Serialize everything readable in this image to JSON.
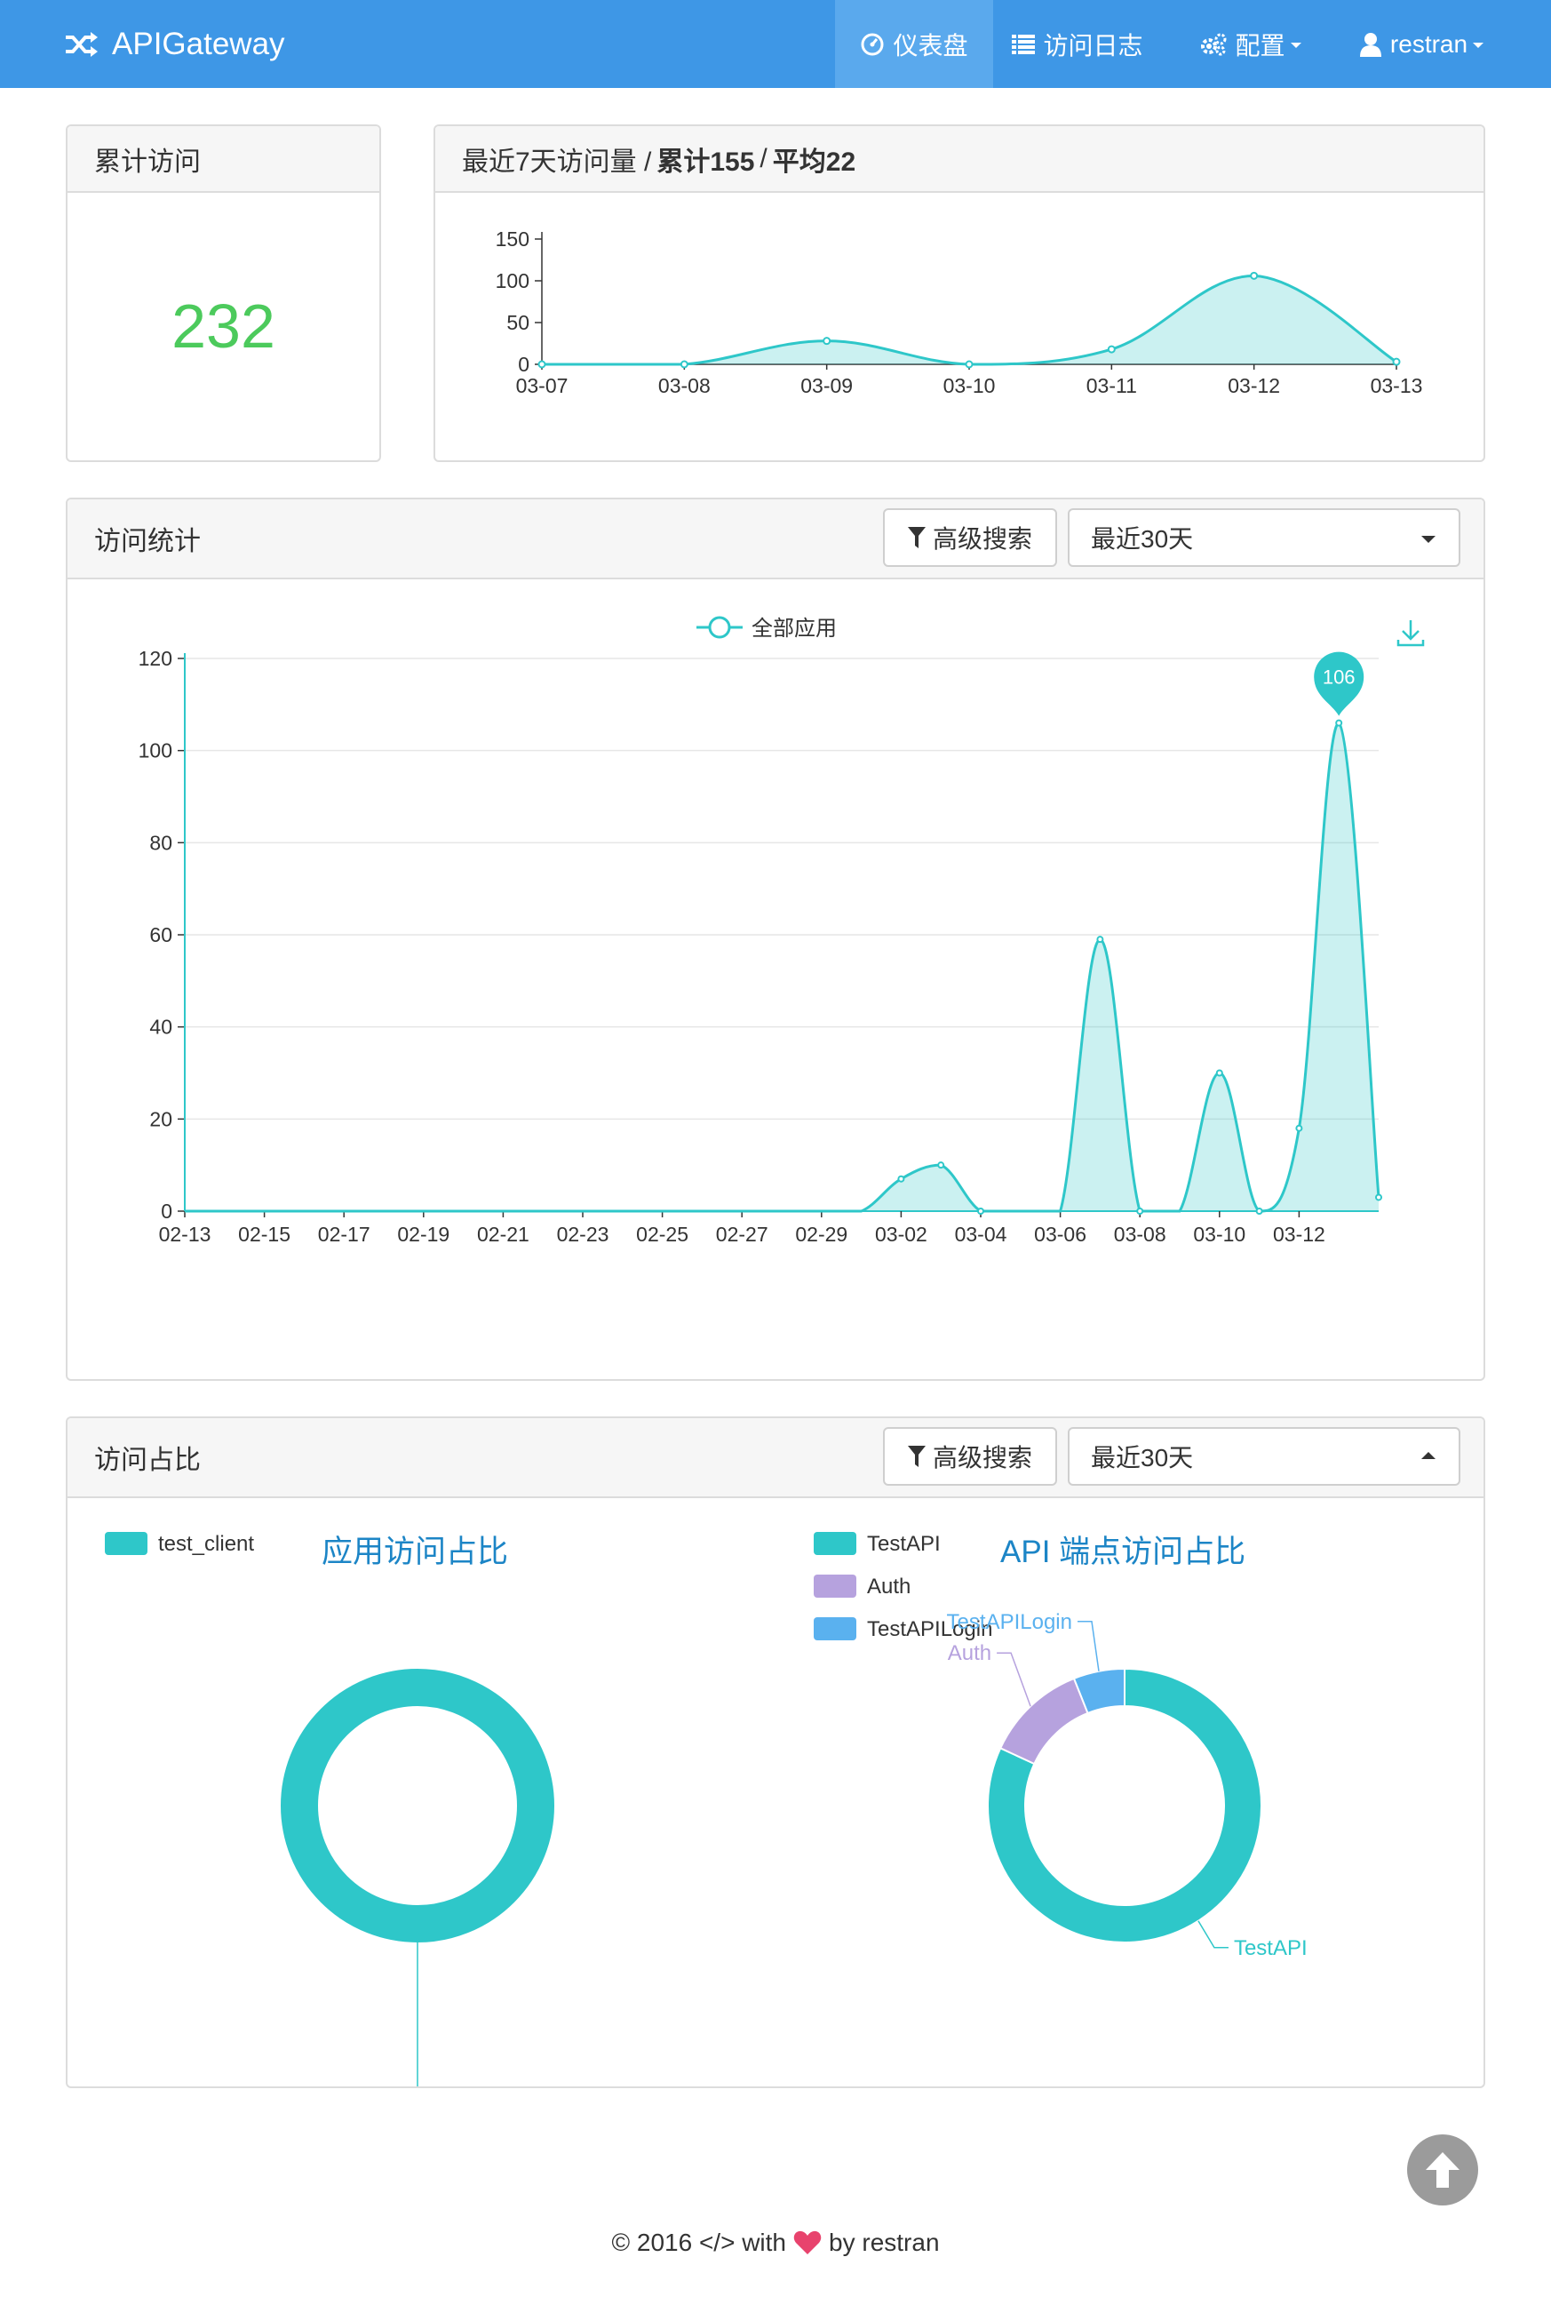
{
  "navbar": {
    "brand": "APIGateway",
    "items": [
      {
        "label": "仪表盘"
      },
      {
        "label": "访问日志"
      },
      {
        "label": "配置"
      },
      {
        "label": "restran"
      }
    ]
  },
  "total_panel": {
    "title": "累计访问",
    "value": "232"
  },
  "week_panel": {
    "title_prefix": "最近7天访问量 /",
    "total_label": "累计155",
    "sep": "/",
    "avg_label": "平均22"
  },
  "stats_panel": {
    "title": "访问统计",
    "search_button": "高级搜索",
    "range_select": "最近30天"
  },
  "share_panel": {
    "title": "访问占比",
    "search_button": "高级搜索",
    "range_select": "最近30天"
  },
  "footer": {
    "copyright": "© 2016 </> with",
    "by": "by restran"
  },
  "colors": {
    "navbar": "#3e97e6",
    "teal": "#2ec7c9",
    "purple": "#b6a2de",
    "blue": "#5ab1ef",
    "big_number": "#4cca5c",
    "heart": "#e8436d"
  },
  "icons": [
    "shuffle-icon",
    "dashboard-icon",
    "list-icon",
    "gears-icon",
    "user-icon",
    "filter-icon",
    "download-icon",
    "arrow-up-icon",
    "heart-icon"
  ],
  "chart_data": [
    {
      "type": "area",
      "x": [
        "03-07",
        "03-08",
        "03-09",
        "03-10",
        "03-11",
        "03-12",
        "03-13"
      ],
      "values": [
        0,
        0,
        28,
        0,
        18,
        106,
        3
      ],
      "ylim": [
        0,
        150
      ],
      "yticks": [
        0,
        50,
        100,
        150
      ],
      "smooth": true
    },
    {
      "type": "area",
      "legend": [
        "全部应用"
      ],
      "legend_position": "top-center",
      "series": [
        {
          "name": "全部应用",
          "values": [
            0,
            0,
            0,
            0,
            0,
            0,
            0,
            0,
            0,
            0,
            0,
            0,
            0,
            0,
            0,
            0,
            0,
            0,
            7,
            10,
            0,
            0,
            0,
            59,
            0,
            0,
            30,
            0,
            18,
            106,
            3
          ]
        }
      ],
      "x": [
        "02-13",
        "02-14",
        "02-15",
        "02-16",
        "02-17",
        "02-18",
        "02-19",
        "02-20",
        "02-21",
        "02-22",
        "02-23",
        "02-24",
        "02-25",
        "02-26",
        "02-27",
        "02-28",
        "02-29",
        "03-01",
        "03-02",
        "03-03",
        "03-04",
        "03-05",
        "03-06",
        "03-07",
        "03-08",
        "03-09",
        "03-10",
        "03-11",
        "03-12",
        "03-13"
      ],
      "x_tick_labels": [
        "02-13",
        "02-15",
        "02-17",
        "02-19",
        "02-21",
        "02-23",
        "02-25",
        "02-27",
        "02-29",
        "03-02",
        "03-04",
        "03-06",
        "03-08",
        "03-10",
        "03-12"
      ],
      "ylim": [
        0,
        120
      ],
      "yticks": [
        0,
        20,
        40,
        60,
        80,
        100,
        120
      ],
      "max_marker": {
        "label": "106",
        "value": 106
      },
      "grid": true
    },
    {
      "type": "pie",
      "title": "应用访问占比",
      "legend": [
        "test_client"
      ],
      "slices": [
        {
          "label": "test_client",
          "value": 232
        }
      ]
    },
    {
      "type": "pie",
      "title": "API 端点访问占比",
      "legend": [
        "TestAPI",
        "Auth",
        "TestAPILogin"
      ],
      "slices": [
        {
          "label": "TestAPI",
          "value": 190
        },
        {
          "label": "Auth",
          "value": 28
        },
        {
          "label": "TestAPILogin",
          "value": 14
        }
      ]
    }
  ]
}
